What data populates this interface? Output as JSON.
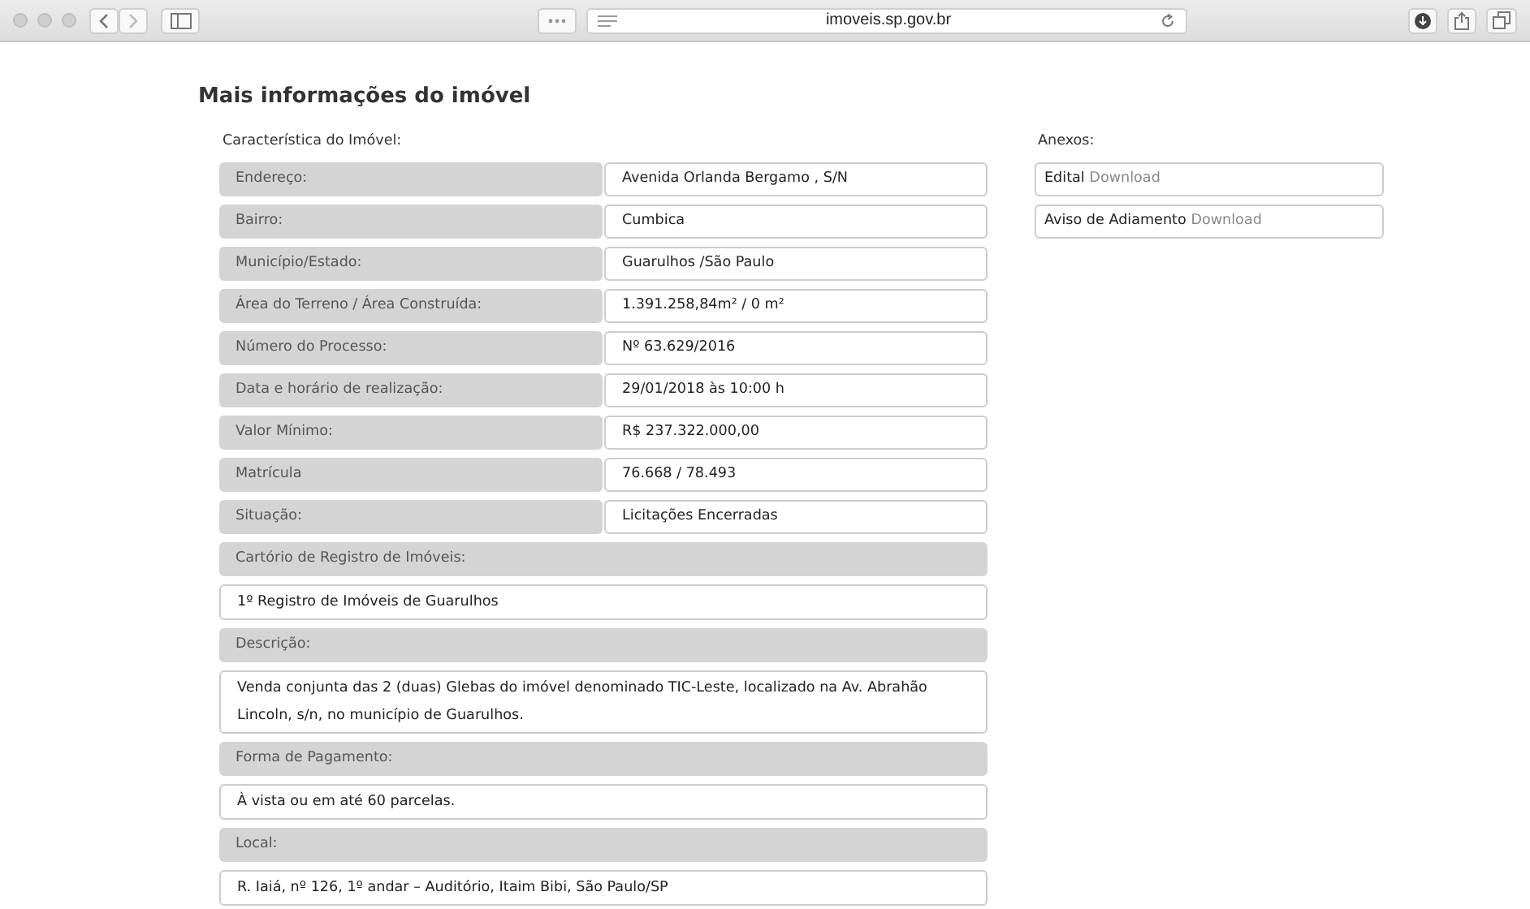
{
  "browser": {
    "url": "imoveis.sp.gov.br"
  },
  "heading": "Mais informações do imóvel",
  "section_label": "Característica do Imóvel:",
  "pairs": [
    {
      "label": "Endereço:",
      "value": "Avenida Orlanda Bergamo , S/N"
    },
    {
      "label": "Bairro:",
      "value": "Cumbica"
    },
    {
      "label": "Município/Estado:",
      "value": "Guarulhos /São Paulo"
    },
    {
      "label": "Área do Terreno / Área Construída:",
      "value": "1.391.258,84m² / 0 m²"
    },
    {
      "label": "Número do Processo:",
      "value": "Nº 63.629/2016"
    },
    {
      "label": "Data e horário de realização:",
      "value": "29/01/2018 às 10:00 h"
    },
    {
      "label": "Valor Mínimo:",
      "value": "R$ 237.322.000,00"
    },
    {
      "label": "Matrícula",
      "value": "76.668 / 78.493"
    },
    {
      "label": "Situação:",
      "value": "Licitações Encerradas"
    }
  ],
  "blocks": [
    {
      "label": "Cartório de Registro de Imóveis:",
      "value": "1º Registro de Imóveis de Guarulhos"
    },
    {
      "label": "Descrição:",
      "value": "Venda conjunta das 2 (duas) Glebas do imóvel denominado TIC-Leste, localizado na Av. Abrahão Lincoln, s/n, no município de Guarulhos."
    },
    {
      "label": "Forma de Pagamento:",
      "value": "À vista ou em até 60 parcelas."
    },
    {
      "label": "Local:",
      "value": "R. Iaiá, nº 126, 1º andar – Auditório, Itaim Bibi, São Paulo/SP"
    }
  ],
  "attachments_label": "Anexos:",
  "attachments": [
    {
      "name": "Edital",
      "link": "Download"
    },
    {
      "name": "Aviso de Adiamento",
      "link": "Download"
    }
  ]
}
